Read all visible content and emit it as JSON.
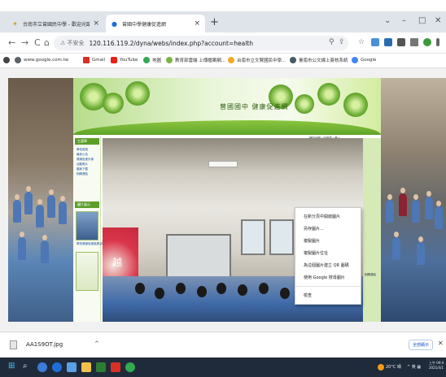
{
  "browser": {
    "tabs": [
      {
        "title": "台南市立曾國民中學 - 歡迎光臨",
        "close": "×",
        "active": false
      },
      {
        "title": "曾國中學健康促進網",
        "close": "×",
        "active": true
      }
    ],
    "new_tab": "+",
    "window_controls": {
      "chevron": "⌄",
      "minimize": "–",
      "maximize": "□",
      "close": "✕"
    },
    "nav": {
      "back": "←",
      "forward": "→",
      "reload": "C",
      "home": "⌂"
    },
    "security_label": "⚠ 不安全",
    "url": "120.116.119.2/dyna/webs/index.php?account=health",
    "omni_icons": {
      "search": "⚲",
      "share": "⇪",
      "star": "☆"
    }
  },
  "bookmarks": [
    {
      "label": "www.google.com.tw",
      "color": "#5f6368"
    },
    {
      "label": "Gmail",
      "color": "#d93025"
    },
    {
      "label": "YouTube",
      "color": "#e62117"
    },
    {
      "label": "地圖",
      "color": "#34a853"
    },
    {
      "label": "教育部雲端 上傳檔案網...",
      "color": "#7cb342"
    },
    {
      "label": "台南市立文賢國民中學...",
      "color": "#f9a825"
    },
    {
      "label": "臺南市公文線上簽核系統",
      "color": "#455a64"
    },
    {
      "label": "Google",
      "color": "#4285f4"
    }
  ],
  "site": {
    "banner_title": "曾國國中 健康促進網",
    "top_links": "網站地圖 | 回首頁 | 登入",
    "menu_head_1": "主選單",
    "menu_items": [
      "學校首頁",
      "最新公告",
      "健康促進計畫",
      "活動照片",
      "檔案下載",
      "相關連結"
    ],
    "menu_head_2": "圖片展示",
    "caption": "學校健康促進推廣活動照片精選",
    "right_label": "相關連結",
    "photo_sign": "越"
  },
  "context_menu": {
    "items": [
      "在新分頁中開啟圖片",
      "另存圖片...",
      "複製圖片",
      "複製圖片位址",
      "為這個圖片建立 QR 圖碼",
      "使用 Google 搜尋圖片",
      "檢查"
    ]
  },
  "downloads": {
    "filename": "AA1S9OT.jpg",
    "chevron": "^",
    "show_all": "全部顯示",
    "close": "✕"
  },
  "taskbar": {
    "start": "⊞",
    "search": "⌕",
    "weather": "20°C 晴",
    "tray": "^ 英 ▦",
    "time": "上午 09:4",
    "date": "2021/4/1"
  }
}
